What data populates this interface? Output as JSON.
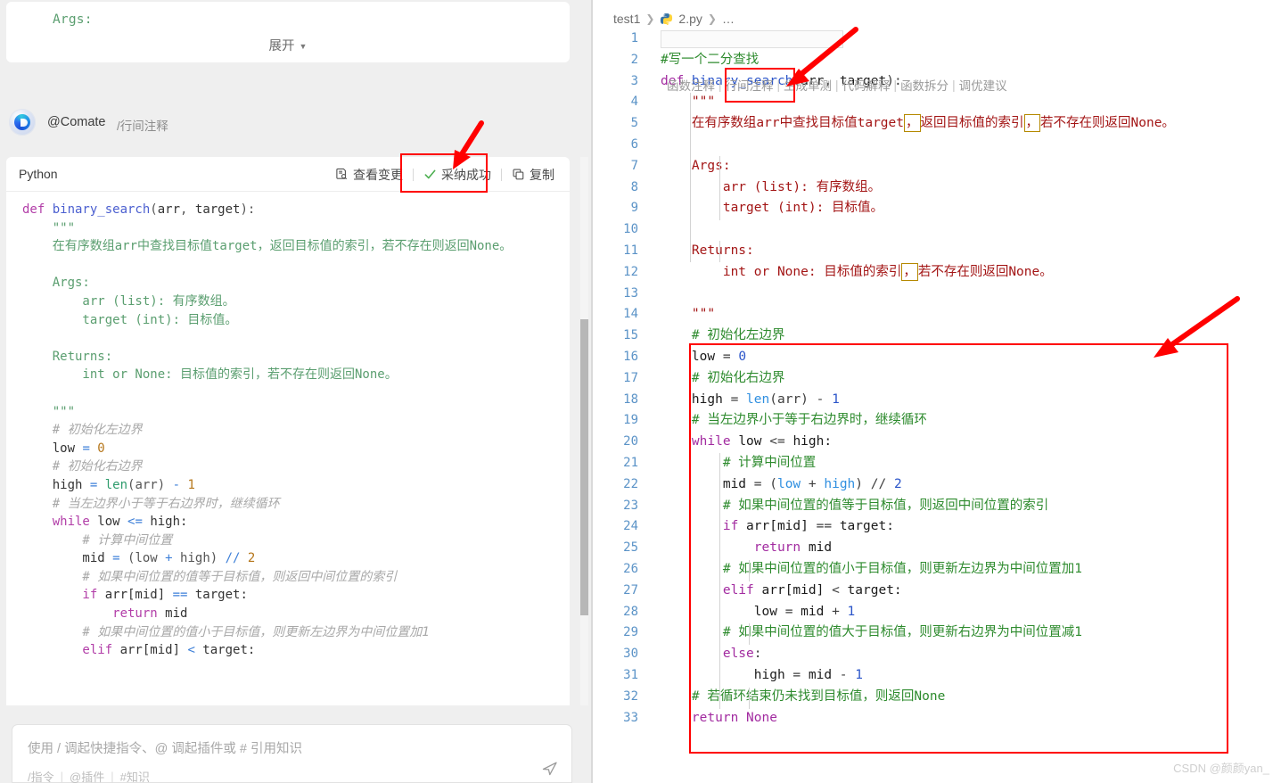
{
  "left_panel": {
    "preview_card": {
      "code_snippet": "Args:",
      "expand_label": "展开",
      "caret_icon": "chevron-down-icon"
    },
    "message_header": {
      "avatar_icon": "comate-avatar-icon",
      "agent_name": "@Comate",
      "command": "/行间注释"
    },
    "code_card": {
      "language": "Python",
      "actions": [
        {
          "icon": "view-changes-icon",
          "label": "查看变更"
        },
        {
          "icon": "check-icon",
          "label": "采纳成功"
        },
        {
          "icon": "copy-icon",
          "label": "复制"
        }
      ],
      "code_lines": [
        [
          {
            "t": "def ",
            "c": "tk-kw"
          },
          {
            "t": "binary_search",
            "c": "tk-fn"
          },
          {
            "t": "(",
            "c": "tk-punct"
          },
          {
            "t": "arr",
            "c": "tk-var"
          },
          {
            "t": ", ",
            "c": "tk-punct"
          },
          {
            "t": "target",
            "c": "tk-var"
          },
          {
            "t": "):",
            "c": "tk-punct"
          }
        ],
        [
          {
            "t": "    \"\"\"",
            "c": "tk-str"
          }
        ],
        [
          {
            "t": "    在有序数组arr中查找目标值target，返回目标值的索引，若不存在则返回None。",
            "c": "tk-str"
          }
        ],
        [
          {
            "t": "",
            "c": "tk-str"
          }
        ],
        [
          {
            "t": "    Args:",
            "c": "tk-str"
          }
        ],
        [
          {
            "t": "        arr (list): 有序数组。",
            "c": "tk-str"
          }
        ],
        [
          {
            "t": "        target (int): 目标值。",
            "c": "tk-str"
          }
        ],
        [
          {
            "t": "",
            "c": "tk-str"
          }
        ],
        [
          {
            "t": "    Returns:",
            "c": "tk-str"
          }
        ],
        [
          {
            "t": "        int or None: 目标值的索引，若不存在则返回None。",
            "c": "tk-str"
          }
        ],
        [
          {
            "t": "",
            "c": "tk-str"
          }
        ],
        [
          {
            "t": "    \"\"\"",
            "c": "tk-str"
          }
        ],
        [
          {
            "t": "    # 初始化左边界",
            "c": "tk-cmt"
          }
        ],
        [
          {
            "t": "    low ",
            "c": "tk-var"
          },
          {
            "t": "= ",
            "c": "tk-op"
          },
          {
            "t": "0",
            "c": "tk-num"
          }
        ],
        [
          {
            "t": "    # 初始化右边界",
            "c": "tk-cmt"
          }
        ],
        [
          {
            "t": "    high ",
            "c": "tk-var"
          },
          {
            "t": "= ",
            "c": "tk-op"
          },
          {
            "t": "len",
            "c": "tk-builtin"
          },
          {
            "t": "(arr) ",
            "c": "tk-punct"
          },
          {
            "t": "- ",
            "c": "tk-op"
          },
          {
            "t": "1",
            "c": "tk-num"
          }
        ],
        [
          {
            "t": "    # 当左边界小于等于右边界时，继续循环",
            "c": "tk-cmt"
          }
        ],
        [
          {
            "t": "    while ",
            "c": "tk-kw"
          },
          {
            "t": "low ",
            "c": "tk-var"
          },
          {
            "t": "<= ",
            "c": "tk-op"
          },
          {
            "t": "high:",
            "c": "tk-var"
          }
        ],
        [
          {
            "t": "        # 计算中间位置",
            "c": "tk-cmt"
          }
        ],
        [
          {
            "t": "        mid ",
            "c": "tk-var"
          },
          {
            "t": "= ",
            "c": "tk-op"
          },
          {
            "t": "(low ",
            "c": "tk-punct"
          },
          {
            "t": "+ ",
            "c": "tk-op"
          },
          {
            "t": "high) ",
            "c": "tk-punct"
          },
          {
            "t": "// ",
            "c": "tk-op"
          },
          {
            "t": "2",
            "c": "tk-num"
          }
        ],
        [
          {
            "t": "        # 如果中间位置的值等于目标值，则返回中间位置的索引",
            "c": "tk-cmt"
          }
        ],
        [
          {
            "t": "        if ",
            "c": "tk-kw"
          },
          {
            "t": "arr[mid] ",
            "c": "tk-var"
          },
          {
            "t": "== ",
            "c": "tk-op"
          },
          {
            "t": "target:",
            "c": "tk-var"
          }
        ],
        [
          {
            "t": "            return ",
            "c": "tk-kw"
          },
          {
            "t": "mid",
            "c": "tk-var"
          }
        ],
        [
          {
            "t": "        # 如果中间位置的值小于目标值，则更新左边界为中间位置加1",
            "c": "tk-cmt"
          }
        ],
        [
          {
            "t": "        elif ",
            "c": "tk-kw"
          },
          {
            "t": "arr[mid] ",
            "c": "tk-var"
          },
          {
            "t": "< ",
            "c": "tk-op"
          },
          {
            "t": "target:",
            "c": "tk-var"
          }
        ]
      ]
    },
    "composer": {
      "placeholder": "使用 / 调起快捷指令、@ 调起插件或 # 引用知识",
      "hints": [
        "/指令",
        "@插件",
        "#知识"
      ],
      "send_icon": "send-icon"
    }
  },
  "right_panel": {
    "breadcrumb": {
      "project": "test1",
      "file_icon": "python-file-icon",
      "file": "2.py",
      "ellipsis": "…",
      "separator": "❯"
    },
    "inline_toolbar": {
      "items": [
        "函数注释",
        "行间注释",
        "生成单测",
        "代码解释",
        "函数拆分",
        "调优建议"
      ],
      "highlighted_item": "行间注释"
    },
    "line_numbers": [
      1,
      2,
      3,
      4,
      5,
      6,
      7,
      8,
      9,
      10,
      11,
      12,
      13,
      14,
      15,
      16,
      17,
      18,
      19,
      20,
      21,
      22,
      23,
      24,
      25,
      26,
      27,
      28,
      29,
      30,
      31,
      32,
      33
    ],
    "code_lines": [
      [],
      [
        {
          "t": "#写一个二分查找",
          "c": "ed-cmt"
        }
      ],
      [
        {
          "t": "def ",
          "c": "ed-kw"
        },
        {
          "t": "binary_search",
          "c": "ed-fn"
        },
        {
          "t": "(",
          "c": "ed-punct"
        },
        {
          "t": "arr",
          "c": "ed-var"
        },
        {
          "t": ", ",
          "c": "ed-punct"
        },
        {
          "t": "target",
          "c": "ed-var"
        },
        {
          "t": "):",
          "c": "ed-punct"
        }
      ],
      [
        {
          "t": "    \"\"\"",
          "c": "ed-doc"
        }
      ],
      [
        {
          "t": "    在有序数组arr中查找目标值target",
          "c": "ed-doc"
        },
        {
          "t": "，",
          "c": "ed-doc",
          "box": true
        },
        {
          "t": "返回目标值的索引",
          "c": "ed-doc"
        },
        {
          "t": "，",
          "c": "ed-doc",
          "box": true
        },
        {
          "t": "若不存在则返回None。",
          "c": "ed-doc"
        }
      ],
      [],
      [
        {
          "t": "    Args:",
          "c": "ed-doc"
        }
      ],
      [
        {
          "t": "        arr (list): 有序数组。",
          "c": "ed-doc"
        }
      ],
      [
        {
          "t": "        target (int): 目标值。",
          "c": "ed-doc"
        }
      ],
      [],
      [
        {
          "t": "    Returns:",
          "c": "ed-doc"
        }
      ],
      [
        {
          "t": "        int or None: 目标值的索引",
          "c": "ed-doc"
        },
        {
          "t": "，",
          "c": "ed-doc",
          "box": true
        },
        {
          "t": "若不存在则返回None。",
          "c": "ed-doc"
        }
      ],
      [],
      [
        {
          "t": "    \"\"\"",
          "c": "ed-doc"
        }
      ],
      [
        {
          "t": "    # 初始化左边界",
          "c": "ed-cmt"
        }
      ],
      [
        {
          "t": "    low ",
          "c": "ed-var"
        },
        {
          "t": "= ",
          "c": "ed-op"
        },
        {
          "t": "0",
          "c": "ed-num"
        }
      ],
      [
        {
          "t": "    # 初始化右边界",
          "c": "ed-cmt"
        }
      ],
      [
        {
          "t": "    high ",
          "c": "ed-var"
        },
        {
          "t": "= ",
          "c": "ed-op"
        },
        {
          "t": "len",
          "c": "ed-builtin"
        },
        {
          "t": "(arr) ",
          "c": "ed-punct"
        },
        {
          "t": "- ",
          "c": "ed-op"
        },
        {
          "t": "1",
          "c": "ed-num"
        }
      ],
      [
        {
          "t": "    # 当左边界小于等于右边界时，继续循环",
          "c": "ed-cmt"
        }
      ],
      [
        {
          "t": "    while ",
          "c": "ed-kw"
        },
        {
          "t": "low ",
          "c": "ed-var"
        },
        {
          "t": "<= ",
          "c": "ed-op"
        },
        {
          "t": "high:",
          "c": "ed-var"
        }
      ],
      [
        {
          "t": "        # 计算中间位置",
          "c": "ed-cmt"
        }
      ],
      [
        {
          "t": "        mid ",
          "c": "ed-var"
        },
        {
          "t": "= ",
          "c": "ed-op"
        },
        {
          "t": "(",
          "c": "ed-punct"
        },
        {
          "t": "low ",
          "c": "ed-builtin"
        },
        {
          "t": "+ ",
          "c": "ed-op"
        },
        {
          "t": "high",
          "c": "ed-builtin"
        },
        {
          "t": ") ",
          "c": "ed-punct"
        },
        {
          "t": "// ",
          "c": "ed-op"
        },
        {
          "t": "2",
          "c": "ed-num"
        }
      ],
      [
        {
          "t": "        # 如果中间位置的值等于目标值，则返回中间位置的索引",
          "c": "ed-cmt"
        }
      ],
      [
        {
          "t": "        if ",
          "c": "ed-kw"
        },
        {
          "t": "arr[mid] ",
          "c": "ed-var"
        },
        {
          "t": "== ",
          "c": "ed-op"
        },
        {
          "t": "target:",
          "c": "ed-var"
        }
      ],
      [
        {
          "t": "            return ",
          "c": "ed-kw"
        },
        {
          "t": "mid",
          "c": "ed-var"
        }
      ],
      [
        {
          "t": "        # 如果中间位置的值小于目标值，则更新左边界为中间位置加1",
          "c": "ed-cmt"
        }
      ],
      [
        {
          "t": "        elif ",
          "c": "ed-kw"
        },
        {
          "t": "arr[mid] ",
          "c": "ed-var"
        },
        {
          "t": "< ",
          "c": "ed-op"
        },
        {
          "t": "target:",
          "c": "ed-var"
        }
      ],
      [
        {
          "t": "            low ",
          "c": "ed-var"
        },
        {
          "t": "= ",
          "c": "ed-op"
        },
        {
          "t": "mid ",
          "c": "ed-var"
        },
        {
          "t": "+ ",
          "c": "ed-op"
        },
        {
          "t": "1",
          "c": "ed-num"
        }
      ],
      [
        {
          "t": "        # 如果中间位置的值大于目标值，则更新右边界为中间位置减1",
          "c": "ed-cmt"
        }
      ],
      [
        {
          "t": "        else",
          "c": "ed-kw"
        },
        {
          "t": ":",
          "c": "ed-punct"
        }
      ],
      [
        {
          "t": "            high ",
          "c": "ed-var"
        },
        {
          "t": "= ",
          "c": "ed-op"
        },
        {
          "t": "mid ",
          "c": "ed-var"
        },
        {
          "t": "- ",
          "c": "ed-op"
        },
        {
          "t": "1",
          "c": "ed-num"
        }
      ],
      [
        {
          "t": "    # 若循环结束仍未找到目标值，则返回None",
          "c": "ed-cmt"
        }
      ],
      [
        {
          "t": "    return ",
          "c": "ed-kw"
        },
        {
          "t": "None",
          "c": "ed-kw"
        }
      ]
    ]
  },
  "annotations": {
    "highlight_color": "#ff0000",
    "arrow_color": "#ff0000",
    "comma_box_color": "#b58900"
  },
  "watermark": "CSDN @颜颜yan_"
}
